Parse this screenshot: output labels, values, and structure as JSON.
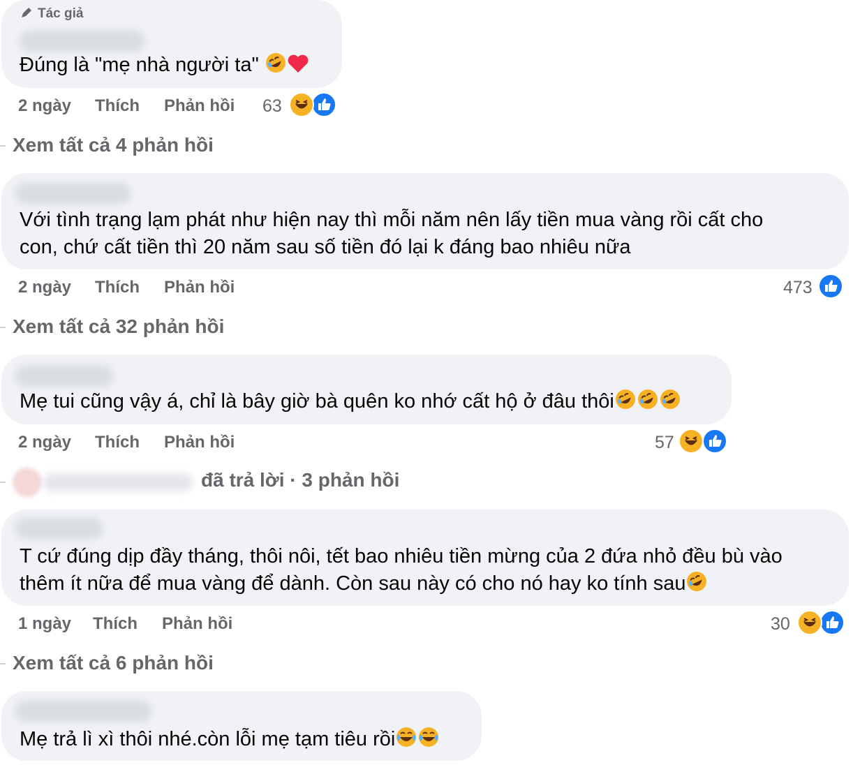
{
  "comments": [
    {
      "badge": "Tác giả",
      "text_lines": [
        "Đúng là \"mẹ nhà người ta\""
      ],
      "emojis": [
        "rofl-emoji",
        "heart-emoji"
      ],
      "time": "2 ngày",
      "like_label": "Thích",
      "reply_label": "Phản hồi",
      "reaction_count": "63",
      "reactions": [
        "haha-reaction",
        "like-reaction"
      ]
    },
    {
      "text_lines": [
        "Với tình trạng lạm phát như hiện nay thì mỗi năm nên lấy tiền mua vàng rồi cất cho",
        "con, chứ cất tiền thì 20 năm sau số tiền đó lại k đáng bao nhiêu nữa"
      ],
      "time": "2 ngày",
      "like_label": "Thích",
      "reply_label": "Phản hồi",
      "reaction_count": "473",
      "reactions": [
        "like-reaction"
      ]
    },
    {
      "text_lines": [
        "Mẹ tui cũng vậy á, chỉ là bây giờ bà quên ko nhớ cất hộ ở đâu thôi"
      ],
      "emojis": [
        "rofl-emoji",
        "rofl-emoji",
        "rofl-emoji"
      ],
      "time": "2 ngày",
      "like_label": "Thích",
      "reply_label": "Phản hồi",
      "reaction_count": "57",
      "reactions": [
        "haha-reaction",
        "like-reaction"
      ]
    },
    {
      "text_lines": [
        "T cứ đúng dịp đầy tháng, thôi nôi, tết bao nhiêu tiền mừng của 2 đứa nhỏ đều bù vào",
        "thêm ít nữa để mua vàng để dành. Còn sau này có cho nó hay ko tính sau"
      ],
      "emojis": [
        "rofl-emoji"
      ],
      "time": "1 ngày",
      "like_label": "Thích",
      "reply_label": "Phản hồi",
      "reaction_count": "30",
      "reactions": [
        "haha-reaction",
        "like-reaction"
      ]
    },
    {
      "text_lines": [
        "Mẹ trả lì xì thôi nhé.còn lỗi mẹ tạm tiêu rồi"
      ],
      "emojis": [
        "joy-emoji",
        "joy-emoji"
      ]
    }
  ],
  "view_all": [
    "Xem tất cả 4 phản hồi",
    "Xem tất cả 32 phản hồi",
    "Xem tất cả 6 phản hồi"
  ],
  "reply_summary": "đã trả lời · 3 phản hồi",
  "colors": {
    "bubble": "#f0f2f5",
    "secondary_text": "#65676b",
    "like_blue": "#1877f2",
    "heart_red": "#f02849"
  }
}
